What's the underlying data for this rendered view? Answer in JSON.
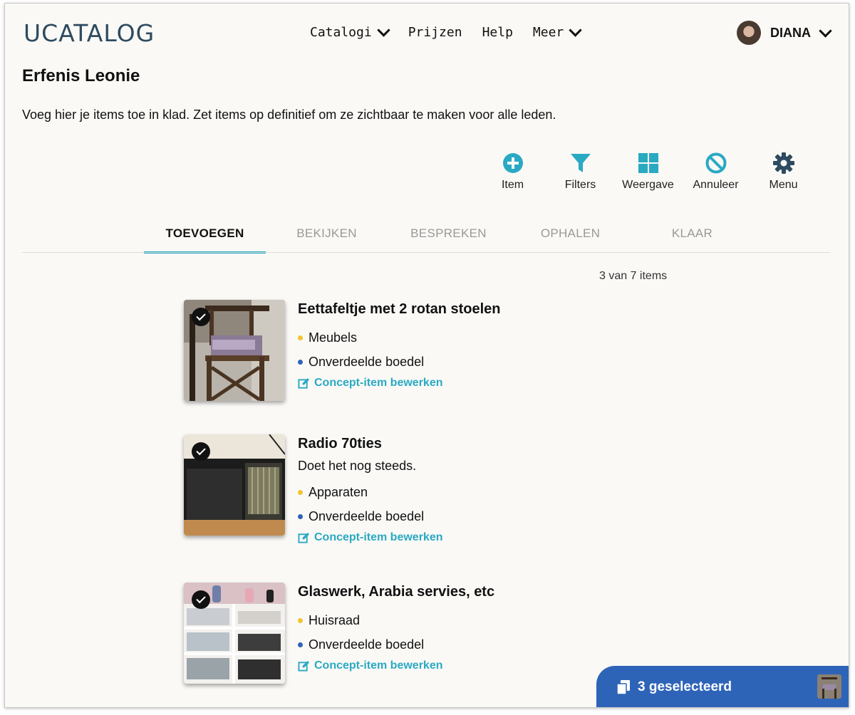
{
  "header": {
    "logo": "UCATALOG",
    "nav": [
      {
        "label": "Catalogi",
        "dropdown": true
      },
      {
        "label": "Prijzen",
        "dropdown": false
      },
      {
        "label": "Help",
        "dropdown": false
      },
      {
        "label": "Meer",
        "dropdown": true
      }
    ],
    "user": {
      "name": "DIANA"
    }
  },
  "page": {
    "title": "Erfenis Leonie",
    "intro": "Voeg hier je items toe in klad. Zet items op definitief om ze zichtbaar te maken voor alle leden."
  },
  "toolbar": [
    {
      "label": "Item",
      "icon": "plus-circle-icon"
    },
    {
      "label": "Filters",
      "icon": "filter-icon"
    },
    {
      "label": "Weergave",
      "icon": "grid-icon"
    },
    {
      "label": "Annuleer",
      "icon": "cancel-icon"
    },
    {
      "label": "Menu",
      "icon": "gear-icon"
    }
  ],
  "tabs": [
    {
      "label": "TOEVOEGEN",
      "active": true
    },
    {
      "label": "BEKIJKEN",
      "active": false
    },
    {
      "label": "BESPREKEN",
      "active": false
    },
    {
      "label": "OPHALEN",
      "active": false
    },
    {
      "label": "KLAAR",
      "active": false
    }
  ],
  "count_text": "3 van 7 items",
  "items": [
    {
      "title": "Eettafeltje met 2 rotan stoelen",
      "description": "",
      "category": "Meubels",
      "status": "Onverdeelde boedel",
      "edit_label": "Concept-item bewerken",
      "image": "chair-photo"
    },
    {
      "title": "Radio 70ties",
      "description": "Doet het nog steeds.",
      "category": "Apparaten",
      "status": "Onverdeelde boedel",
      "edit_label": "Concept-item bewerken",
      "image": "radio-photo"
    },
    {
      "title": "Glaswerk, Arabia servies, etc",
      "description": "",
      "category": "Huisraad",
      "status": "Onverdeelde boedel",
      "edit_label": "Concept-item bewerken",
      "image": "cupboard-photo"
    }
  ],
  "selection_bar": {
    "label": "3 geselecteerd",
    "icon": "copy-icon"
  },
  "colors": {
    "accent": "#2aa9c3",
    "logo": "#2e4b60",
    "category_dot": "#f4c430",
    "status_dot": "#2e64b8",
    "selection_bar": "#2e64b8"
  }
}
